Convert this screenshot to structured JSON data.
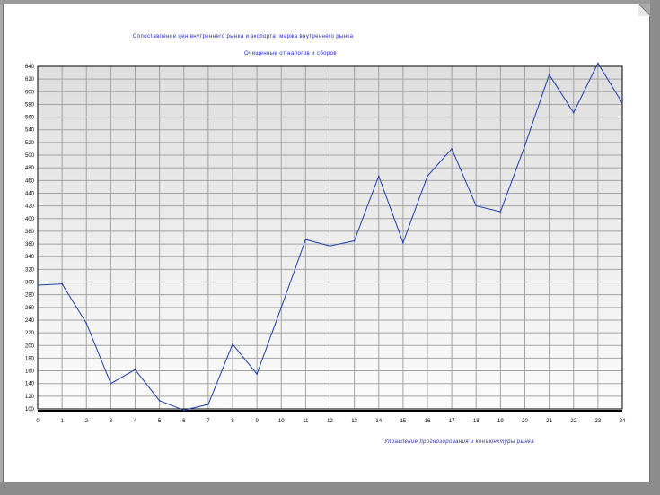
{
  "chart_data": {
    "type": "line",
    "title": "Сопоставление цен внутреннего рынка и экспорта: маржа внутреннего рынка",
    "subtitle": "Очищенные от налогов и сборов",
    "footer": "Управление прогнозирования и конъюнктуры рынка",
    "xlabel": "",
    "ylabel": "",
    "x": [
      0,
      1,
      2,
      3,
      4,
      5,
      6,
      7,
      8,
      9,
      10,
      11,
      12,
      13,
      14,
      15,
      16,
      17,
      18,
      19,
      20,
      21,
      22,
      23,
      24
    ],
    "series": [
      {
        "values": [
          295,
          297,
          235,
          140,
          162,
          113,
          98,
          107,
          202,
          155,
          260,
          367,
          357,
          365,
          467,
          362,
          467,
          510,
          420,
          411,
          515,
          627,
          567,
          645,
          582
        ],
        "color": "#1e3fb0"
      }
    ],
    "xlim": [
      0,
      24
    ],
    "ylim": [
      100,
      640
    ],
    "yticks": [
      100,
      120,
      140,
      160,
      180,
      200,
      220,
      240,
      260,
      280,
      300,
      320,
      340,
      360,
      380,
      400,
      420,
      440,
      460,
      480,
      500,
      520,
      540,
      560,
      580,
      600,
      620,
      640
    ],
    "grid": true,
    "legend": "none"
  },
  "colors": {
    "plot_bg_top": "#dedede",
    "plot_bg_bottom": "#fbfbfb",
    "grid": "#a3a3a3",
    "axis": "#000000",
    "line": "#1e3fb0",
    "title": "#1f1fd4"
  }
}
